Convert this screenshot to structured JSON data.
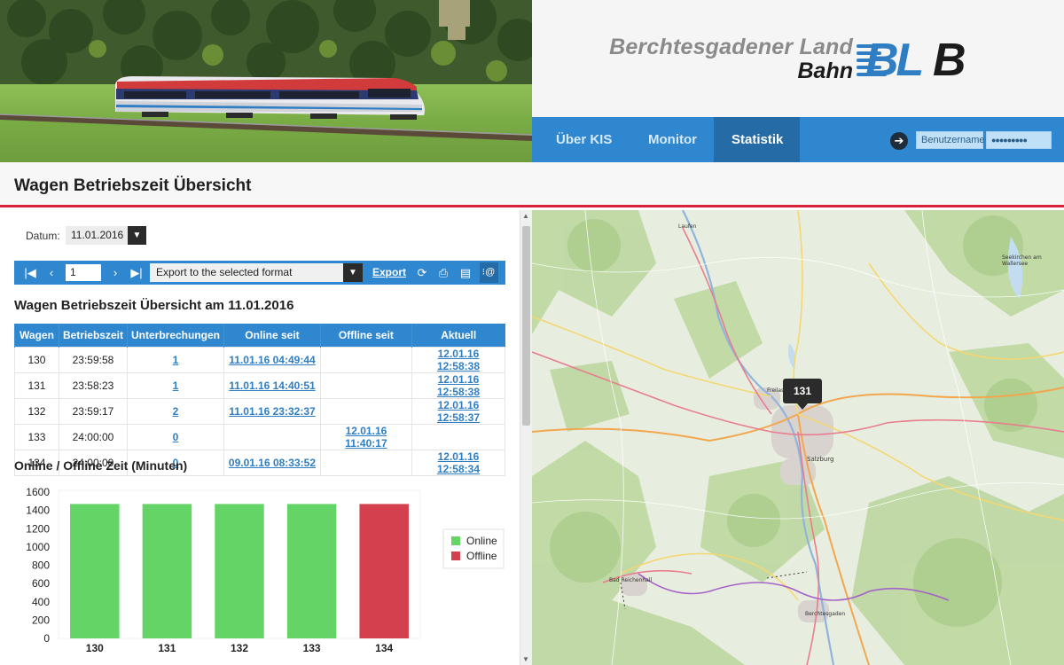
{
  "header": {
    "brand_line1": "Berchtesgadener Land",
    "brand_line2": "Bahn",
    "logo_text_blue": "BL",
    "logo_text_dark": "B",
    "brand_color": "#2f7ec4"
  },
  "nav": {
    "items": [
      {
        "label": "Über KIS",
        "active": false
      },
      {
        "label": "Monitor",
        "active": false
      },
      {
        "label": "Statistik",
        "active": true
      }
    ],
    "login_icon": "arrow-right-circle-icon",
    "username_placeholder": "Benutzername",
    "password_value": "●●●●●●●●●"
  },
  "page": {
    "title": "Wagen Betriebszeit Übersicht",
    "accent_color": "#d8213b"
  },
  "filter": {
    "datum_label": "Datum:",
    "datum_value": "11.01.2016"
  },
  "toolbar": {
    "page_value": "1",
    "export_format": "Export to the selected format",
    "export_label": "Export",
    "icons": [
      "first-page-icon",
      "prev-page-icon",
      "next-page-icon",
      "last-page-icon",
      "refresh-icon",
      "print-layout-icon",
      "print-icon",
      "toggle-params-icon"
    ]
  },
  "report": {
    "title": "Wagen Betriebszeit Übersicht am 11.01.2016",
    "columns": [
      "Wagen",
      "Betriebszeit",
      "Unterbrechungen",
      "Online seit",
      "Offline seit",
      "Aktuell"
    ],
    "rows": [
      {
        "wagen": "130",
        "betriebszeit": "23:59:58",
        "unterbrechungen": "1",
        "online": "11.01.16 04:49:44",
        "offline": "",
        "aktuell": "12.01.16 12:58:38"
      },
      {
        "wagen": "131",
        "betriebszeit": "23:58:23",
        "unterbrechungen": "1",
        "online": "11.01.16 14:40:51",
        "offline": "",
        "aktuell": "12.01.16 12:58:38"
      },
      {
        "wagen": "132",
        "betriebszeit": "23:59:17",
        "unterbrechungen": "2",
        "online": "11.01.16 23:32:37",
        "offline": "",
        "aktuell": "12.01.16 12:58:37"
      },
      {
        "wagen": "133",
        "betriebszeit": "24:00:00",
        "unterbrechungen": "0",
        "online": "",
        "offline": "12.01.16 11:40:17",
        "aktuell": ""
      },
      {
        "wagen": "134",
        "betriebszeit": "24:00:00",
        "unterbrechungen": "0",
        "online": "09.01.16 08:33:52",
        "offline": "",
        "aktuell": "12.01.16 12:58:34"
      }
    ]
  },
  "chart_title": "Online / Offline Zeit (Minuten)",
  "chart_data": {
    "type": "bar",
    "categories": [
      "130",
      "131",
      "132",
      "133",
      "134"
    ],
    "values": [
      1470,
      1470,
      1470,
      1470,
      1470
    ],
    "status": [
      "Online",
      "Online",
      "Online",
      "Online",
      "Offline"
    ],
    "ylim": [
      0,
      1600
    ],
    "yticks": [
      0,
      200,
      400,
      600,
      800,
      1000,
      1200,
      1400,
      1600
    ],
    "legend": [
      {
        "name": "Online",
        "color": "#64d466"
      },
      {
        "name": "Offline",
        "color": "#d5404f"
      }
    ],
    "legend_position": "right",
    "grid": false
  },
  "map": {
    "marker_label": "131",
    "places": [
      "Freilassing",
      "Salzburg",
      "Bad Reichenhall",
      "Berchtesgaden",
      "Seekirchen am Wallersee",
      "Laufen"
    ]
  }
}
